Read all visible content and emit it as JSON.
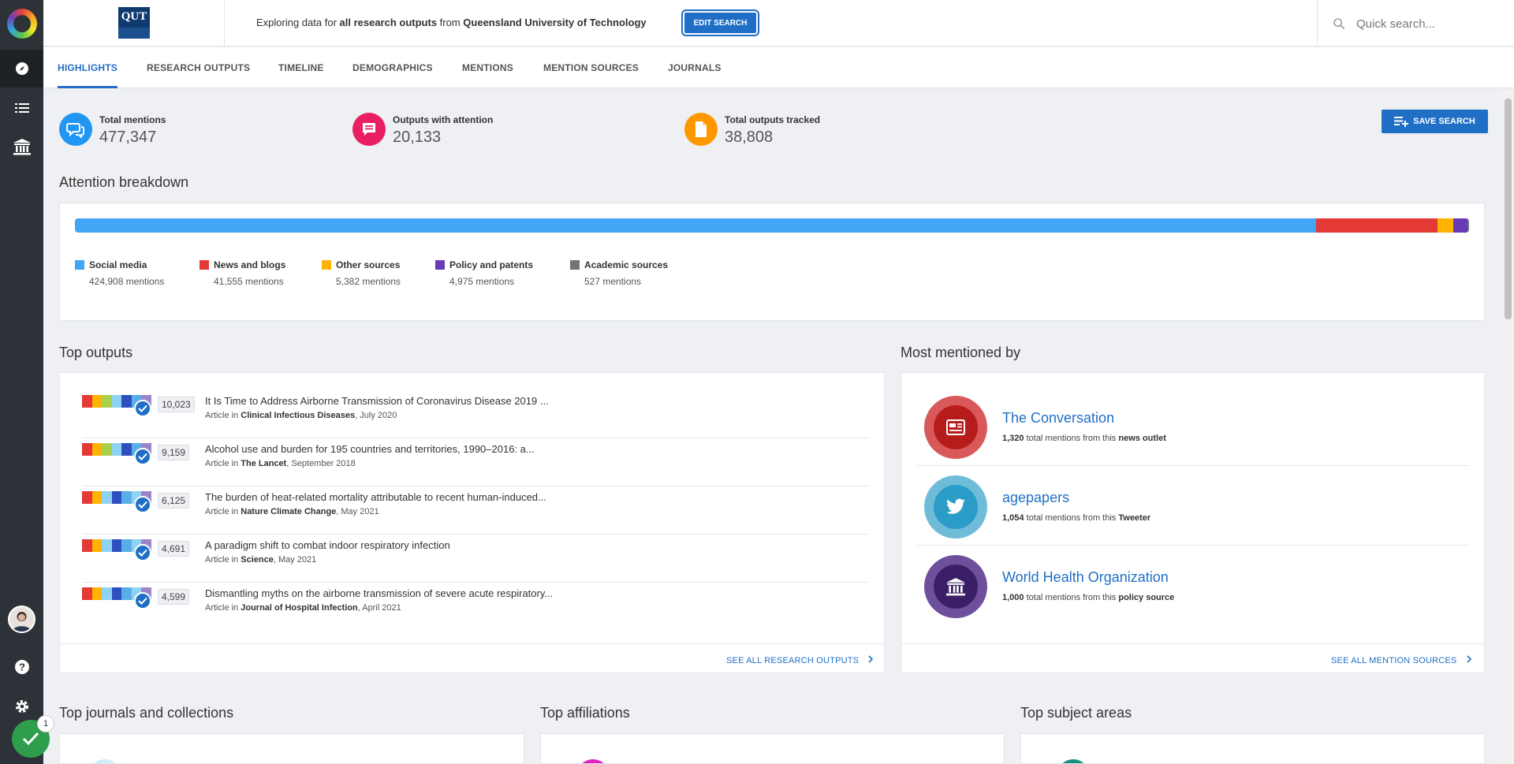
{
  "header": {
    "explore_prefix": "Exploring data for ",
    "explore_scope": "all research outputs",
    "explore_mid": " from ",
    "explore_institution": "Queensland University of Technology",
    "edit_search_label": "EDIT SEARCH",
    "quick_search_placeholder": "Quick search...",
    "logo_text": "QUT"
  },
  "tabs": [
    "HIGHLIGHTS",
    "RESEARCH OUTPUTS",
    "TIMELINE",
    "DEMOGRAPHICS",
    "MENTIONS",
    "MENTION SOURCES",
    "JOURNALS"
  ],
  "active_tab": "HIGHLIGHTS",
  "stats": [
    {
      "label": "Total mentions",
      "value": "477,347",
      "color": "#2196f3",
      "icon": "chat-bubbles-icon"
    },
    {
      "label": "Outputs with attention",
      "value": "20,133",
      "color": "#e91e63",
      "icon": "comment-icon"
    },
    {
      "label": "Total outputs tracked",
      "value": "38,808",
      "color": "#ff9800",
      "icon": "document-icon"
    }
  ],
  "save_search_label": "SAVE SEARCH",
  "attention": {
    "title": "Attention breakdown",
    "categories": [
      {
        "name": "Social media",
        "count": "424,908 mentions",
        "value": 424908,
        "color": "#42a5f5"
      },
      {
        "name": "News and blogs",
        "count": "41,555 mentions",
        "value": 41555,
        "color": "#e53935"
      },
      {
        "name": "Other sources",
        "count": "5,382 mentions",
        "value": 5382,
        "color": "#ffb300"
      },
      {
        "name": "Policy and patents",
        "count": "4,975 mentions",
        "value": 4975,
        "color": "#673ab7"
      },
      {
        "name": "Academic sources",
        "count": "527 mentions",
        "value": 527,
        "color": "#757575"
      }
    ]
  },
  "top_outputs": {
    "title": "Top outputs",
    "items": [
      {
        "score": "10,023",
        "title": "It Is Time to Address Airborne Transmission of Coronavirus Disease 2019 ...",
        "type": "Article in ",
        "journal": "Clinical Infectious Diseases",
        "date": ", July 2020"
      },
      {
        "score": "9,159",
        "title": "Alcohol use and burden for 195 countries and territories, 1990–2016: a...",
        "type": "Article in ",
        "journal": "The Lancet",
        "date": ", September 2018"
      },
      {
        "score": "6,125",
        "title": "The burden of heat-related mortality attributable to recent human-induced...",
        "type": "Article in ",
        "journal": "Nature Climate Change",
        "date": ", May 2021"
      },
      {
        "score": "4,691",
        "title": "A paradigm shift to combat indoor respiratory infection",
        "type": "Article in ",
        "journal": "Science",
        "date": ", May 2021"
      },
      {
        "score": "4,599",
        "title": "Dismantling myths on the airborne transmission of severe acute respiratory...",
        "type": "Article in ",
        "journal": "Journal of Hospital Infection",
        "date": ", April 2021"
      }
    ],
    "see_all": "SEE ALL RESEARCH OUTPUTS"
  },
  "most_mentioned": {
    "title": "Most mentioned by",
    "items": [
      {
        "name": "The Conversation",
        "count": "1,320",
        "mid": " total mentions from this ",
        "kind": "news outlet",
        "color": "#c62828",
        "icon": "newspaper-icon"
      },
      {
        "name": "agepapers",
        "count": "1,054",
        "mid": " total mentions from this ",
        "kind": "Tweeter",
        "color": "#2b9cc7",
        "icon": "twitter-icon"
      },
      {
        "name": "World Health Organization",
        "count": "1,000",
        "mid": " total mentions from this ",
        "kind": "policy source",
        "color": "#4a2a7a",
        "icon": "institution-icon"
      }
    ],
    "see_all": "SEE ALL MENTION SOURCES"
  },
  "bottom_sections": [
    "Top journals and collections",
    "Top affiliations",
    "Top subject areas"
  ],
  "notification_count": "1"
}
